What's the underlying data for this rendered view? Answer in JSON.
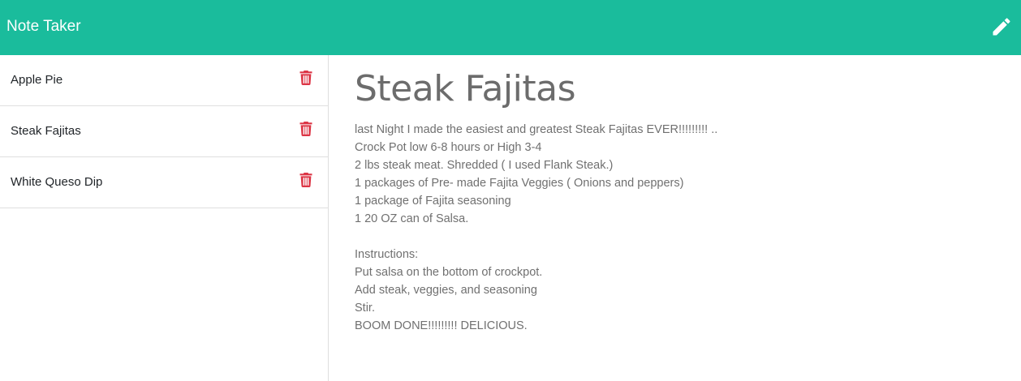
{
  "navbar": {
    "brand": "Note Taker",
    "new_note_icon": "pencil-icon"
  },
  "sidebar": {
    "notes": [
      {
        "title": "Apple Pie",
        "delete_icon": "trash-icon"
      },
      {
        "title": "Steak Fajitas",
        "delete_icon": "trash-icon"
      },
      {
        "title": "White Queso Dip",
        "delete_icon": "trash-icon"
      }
    ]
  },
  "active_note": {
    "title": "Steak Fajitas",
    "body_lines": [
      "last Night I made the easiest and greatest Steak Fajitas EVER!!!!!!!!! ..",
      "Crock Pot low 6-8 hours or High 3-4",
      "2 lbs steak meat. Shredded ( I used Flank Steak.)",
      "1 packages of Pre- made Fajita Veggies ( Onions and peppers)",
      "1 package of Fajita seasoning",
      "1 20 OZ can of Salsa.",
      "",
      "Instructions:",
      "Put salsa on the bottom of crockpot.",
      "Add steak, veggies, and seasoning",
      "Stir.",
      "BOOM DONE!!!!!!!!! DELICIOUS."
    ]
  },
  "colors": {
    "navbar": "#1abc9c",
    "delete_icon": "#dc3545",
    "note_text": "#707070"
  }
}
